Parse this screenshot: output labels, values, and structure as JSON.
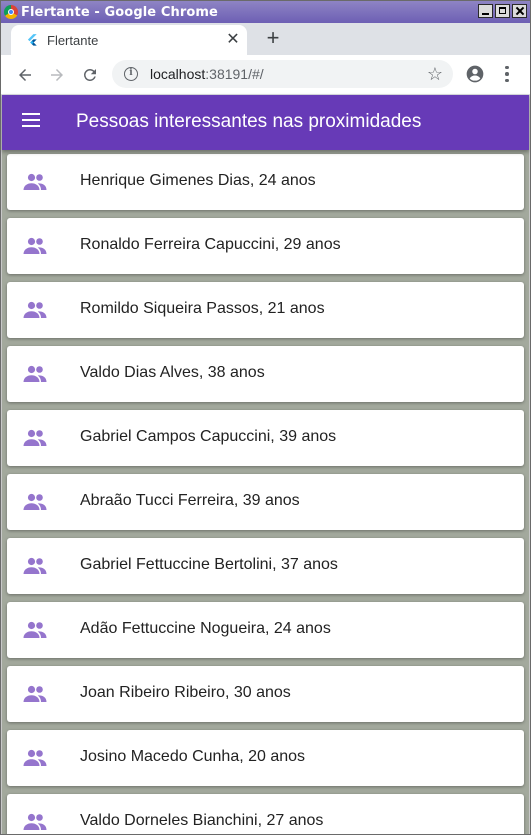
{
  "window": {
    "title": "Flertante - Google Chrome"
  },
  "tab": {
    "title": "Flertante",
    "close_glyph": "✕"
  },
  "toolbar": {
    "url_host": "localhost",
    "url_rest": ":38191/#/",
    "new_tab_glyph": "+"
  },
  "icons": {
    "back": "arrow-left-icon",
    "forward": "arrow-right-icon",
    "reload": "reload-icon",
    "info": "info-icon",
    "star": "star-icon",
    "profile": "account-circle-icon",
    "menu": "more-vert-icon",
    "hamburger": "hamburger-menu-icon",
    "person": "people-icon"
  },
  "colors": {
    "app_bar": "#673ab7",
    "people_icon": "#9575cd",
    "background": "#a3a99d"
  },
  "app": {
    "title": "Pessoas interessantes nas proximidades"
  },
  "people": [
    {
      "label": "Henrique Gimenes Dias, 24 anos"
    },
    {
      "label": "Ronaldo Ferreira Capuccini, 29 anos"
    },
    {
      "label": "Romildo Siqueira Passos, 21 anos"
    },
    {
      "label": "Valdo Dias Alves, 38 anos"
    },
    {
      "label": "Gabriel Campos Capuccini, 39 anos"
    },
    {
      "label": "Abraão Tucci Ferreira, 39 anos"
    },
    {
      "label": "Gabriel Fettuccine Bertolini, 37 anos"
    },
    {
      "label": "Adão Fettuccine Nogueira, 24 anos"
    },
    {
      "label": "Joan Ribeiro Ribeiro, 30 anos"
    },
    {
      "label": "Josino Macedo Cunha, 20 anos"
    },
    {
      "label": "Valdo Dorneles Bianchini, 27 anos"
    }
  ]
}
